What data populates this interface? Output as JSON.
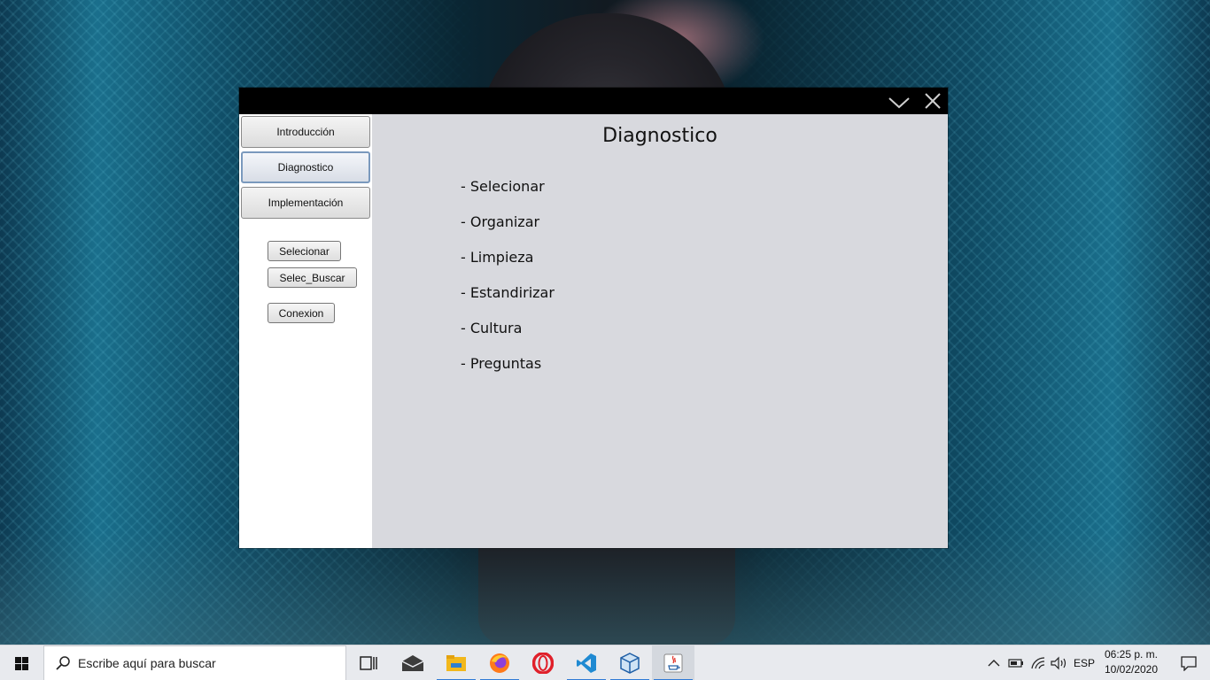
{
  "window": {
    "title_buttons": {
      "minimize_icon": "chevron-down-icon",
      "close_icon": "close-icon"
    }
  },
  "sidebar": {
    "nav": [
      {
        "label": "Introducción"
      },
      {
        "label": "Diagnostico",
        "active": true
      },
      {
        "label": "Implementación"
      }
    ],
    "actions": {
      "selecionar": "Selecionar",
      "selec_buscar": "Selec_Buscar",
      "conexion": "Conexion"
    }
  },
  "main": {
    "title": "Diagnostico",
    "items": [
      "- Selecionar",
      "- Organizar",
      "- Limpieza",
      "- Estandirizar",
      "- Cultura",
      "- Preguntas"
    ]
  },
  "taskbar": {
    "search_placeholder": "Escribe aquí para buscar",
    "apps": [
      "task-view",
      "mail",
      "file-explorer",
      "firefox",
      "opera",
      "vscode",
      "virtualbox",
      "java"
    ],
    "language": "ESP",
    "time": "06:25 p. m.",
    "date": "10/02/2020",
    "accent_color": "#2f7ad6"
  }
}
